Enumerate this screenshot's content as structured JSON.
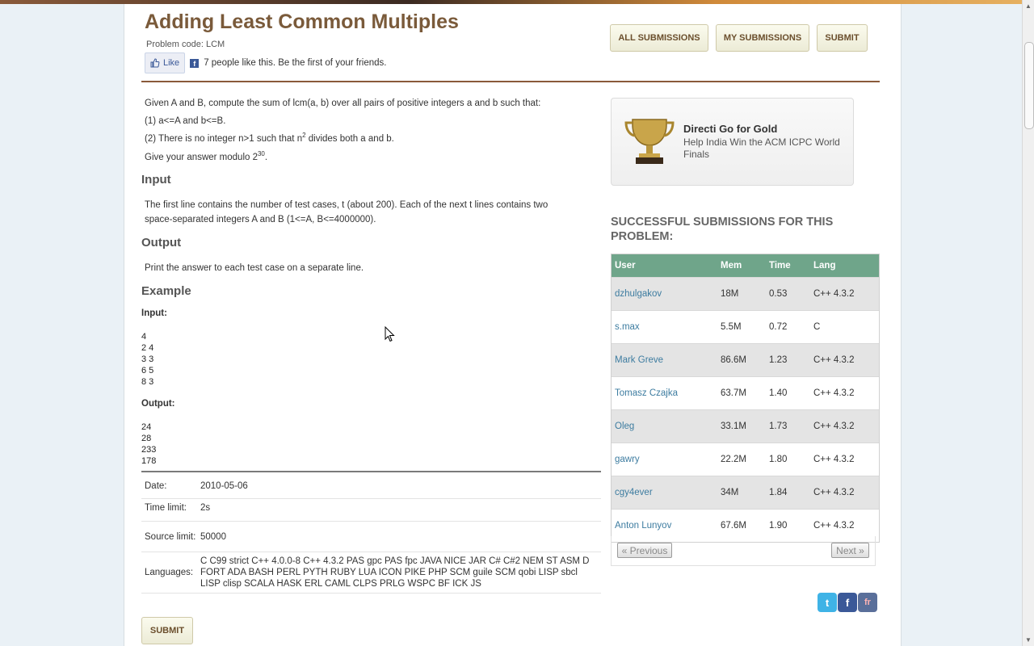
{
  "problem": {
    "title": "Adding Least Common Multiples",
    "code_label": "Problem code: LCM",
    "like_label": "Like",
    "like_text": "7 people like this. Be the first of your friends."
  },
  "top_buttons": {
    "all": "ALL SUBMISSIONS",
    "mine": "MY SUBMISSIONS",
    "submit": "SUBMIT"
  },
  "statement": {
    "line1": "Given A and B, compute the sum of lcm(a, b) over all pairs of positive integers a and b such that:",
    "line2": "(1) a<=A and b<=B.",
    "line3_pre": "(2) There is no integer n>1 such that n",
    "line3_sup": "2",
    "line3_post": " divides both a and b.",
    "line4_pre": "Give your answer modulo 2",
    "line4_sup": "30",
    "line4_post": "."
  },
  "input_section": {
    "heading": "Input",
    "text1": "The first line contains the number of test cases, t (about 200). Each of the next t lines contains two",
    "text2": "space-separated integers A and B (1<=A, B<=4000000)."
  },
  "output_section": {
    "heading": "Output",
    "text": "Print the answer to each test case on a separate line."
  },
  "example": {
    "heading": "Example",
    "input_label": "Input:",
    "input_text": "4\n2 4\n3 3\n6 5\n8 3",
    "output_label": "Output:",
    "output_text": "24\n28\n233\n178"
  },
  "meta": {
    "date_label": "Date:",
    "date": "2010-05-06",
    "time_label": "Time limit:",
    "time": "2s",
    "source_label": "Source limit:",
    "source": "50000",
    "lang_label": "Languages:",
    "languages": "C C99 strict C++ 4.0.0-8 C++ 4.3.2 PAS gpc PAS fpc JAVA NICE JAR C# C#2 NEM ST ASM D FORT ADA BASH PERL PYTH RUBY LUA ICON PIKE PHP SCM guile SCM qobi LISP sbcl LISP clisp SCALA HASK ERL CAML CLPS PRLG WSPC BF ICK JS"
  },
  "submit_bottom": "SUBMIT",
  "ad": {
    "title": "Directi Go for Gold",
    "subtitle": "Help India Win the ACM ICPC World Finals"
  },
  "submissions": {
    "heading": "SUCCESSFUL SUBMISSIONS FOR THIS PROBLEM:",
    "columns": [
      "User",
      "Mem",
      "Time",
      "Lang"
    ],
    "rows": [
      [
        "dzhulgakov",
        "18M",
        "0.53",
        "C++ 4.3.2"
      ],
      [
        "s.max",
        "5.5M",
        "0.72",
        "C"
      ],
      [
        "Mark Greve",
        "86.6M",
        "1.23",
        "C++ 4.3.2"
      ],
      [
        "Tomasz Czajka",
        "63.7M",
        "1.40",
        "C++ 4.3.2"
      ],
      [
        "Oleg",
        "33.1M",
        "1.73",
        "C++ 4.3.2"
      ],
      [
        "gawry",
        "22.2M",
        "1.80",
        "C++ 4.3.2"
      ],
      [
        "cgy4ever",
        "34M",
        "1.84",
        "C++ 4.3.2"
      ],
      [
        "Anton Lunyov",
        "67.6M",
        "1.90",
        "C++ 4.3.2"
      ]
    ],
    "prev_label": "« Previous",
    "next_label": "Next »"
  },
  "social": {
    "twitter": "t",
    "facebook": "f",
    "friendfeed": "fr"
  },
  "colors": {
    "brand_brown": "#7a5a3a",
    "table_header": "#6fa58a",
    "link": "#3d7ca0"
  }
}
